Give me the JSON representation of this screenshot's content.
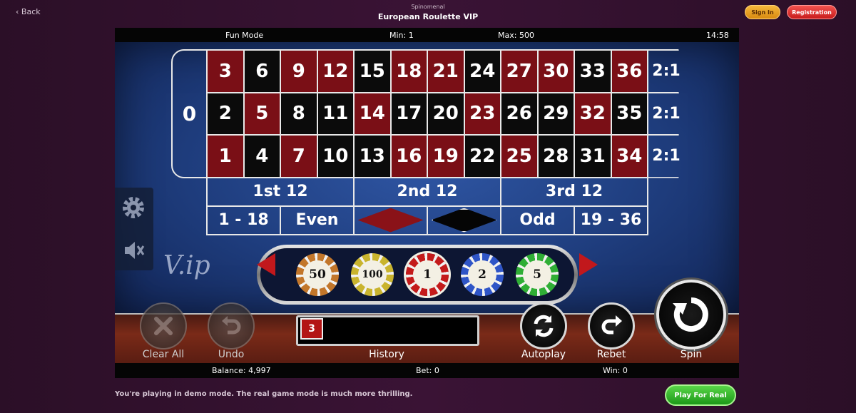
{
  "header": {
    "back_label": "Back",
    "provider": "Spinomenal",
    "game_title": "European Roulette VIP",
    "sign_in": "Sign In",
    "registration": "Registration"
  },
  "topbar": {
    "mode": "Fun Mode",
    "min": "Min: 1",
    "max": "Max: 500",
    "clock": "14:58"
  },
  "table": {
    "zero": "0",
    "rows": [
      [
        "3",
        "6",
        "9",
        "12",
        "15",
        "18",
        "21",
        "24",
        "27",
        "30",
        "33",
        "36"
      ],
      [
        "2",
        "5",
        "8",
        "11",
        "14",
        "17",
        "20",
        "23",
        "26",
        "29",
        "32",
        "35"
      ],
      [
        "1",
        "4",
        "7",
        "10",
        "13",
        "16",
        "19",
        "22",
        "25",
        "28",
        "31",
        "34"
      ]
    ],
    "colors": [
      [
        "red",
        "black",
        "red",
        "red",
        "black",
        "red",
        "red",
        "black",
        "red",
        "red",
        "black",
        "red"
      ],
      [
        "black",
        "red",
        "black",
        "black",
        "red",
        "black",
        "black",
        "red",
        "black",
        "black",
        "red",
        "black"
      ],
      [
        "red",
        "black",
        "red",
        "black",
        "black",
        "red",
        "red",
        "black",
        "red",
        "black",
        "black",
        "red"
      ]
    ],
    "column_bets": [
      "2:1",
      "2:1",
      "2:1"
    ],
    "dozens": [
      "1st 12",
      "2nd 12",
      "3rd 12"
    ],
    "even_money": {
      "low": "1 - 18",
      "even": "Even",
      "odd": "Odd",
      "high": "19 - 36"
    }
  },
  "logo_text": "V.ip",
  "chips": [
    "50",
    "100",
    "1",
    "2",
    "5"
  ],
  "controls": {
    "clear_all": "Clear All",
    "undo": "Undo",
    "history": "History",
    "history_last": "3",
    "autoplay": "Autoplay",
    "rebet": "Rebet",
    "spin": "Spin"
  },
  "status": {
    "balance": "Balance: 4,997",
    "bet": "Bet: 0",
    "win": "Win: 0"
  },
  "footer": {
    "demo_notice": "You're playing in demo mode. The real game mode is much more thrilling.",
    "play_for_real": "Play For Real"
  }
}
